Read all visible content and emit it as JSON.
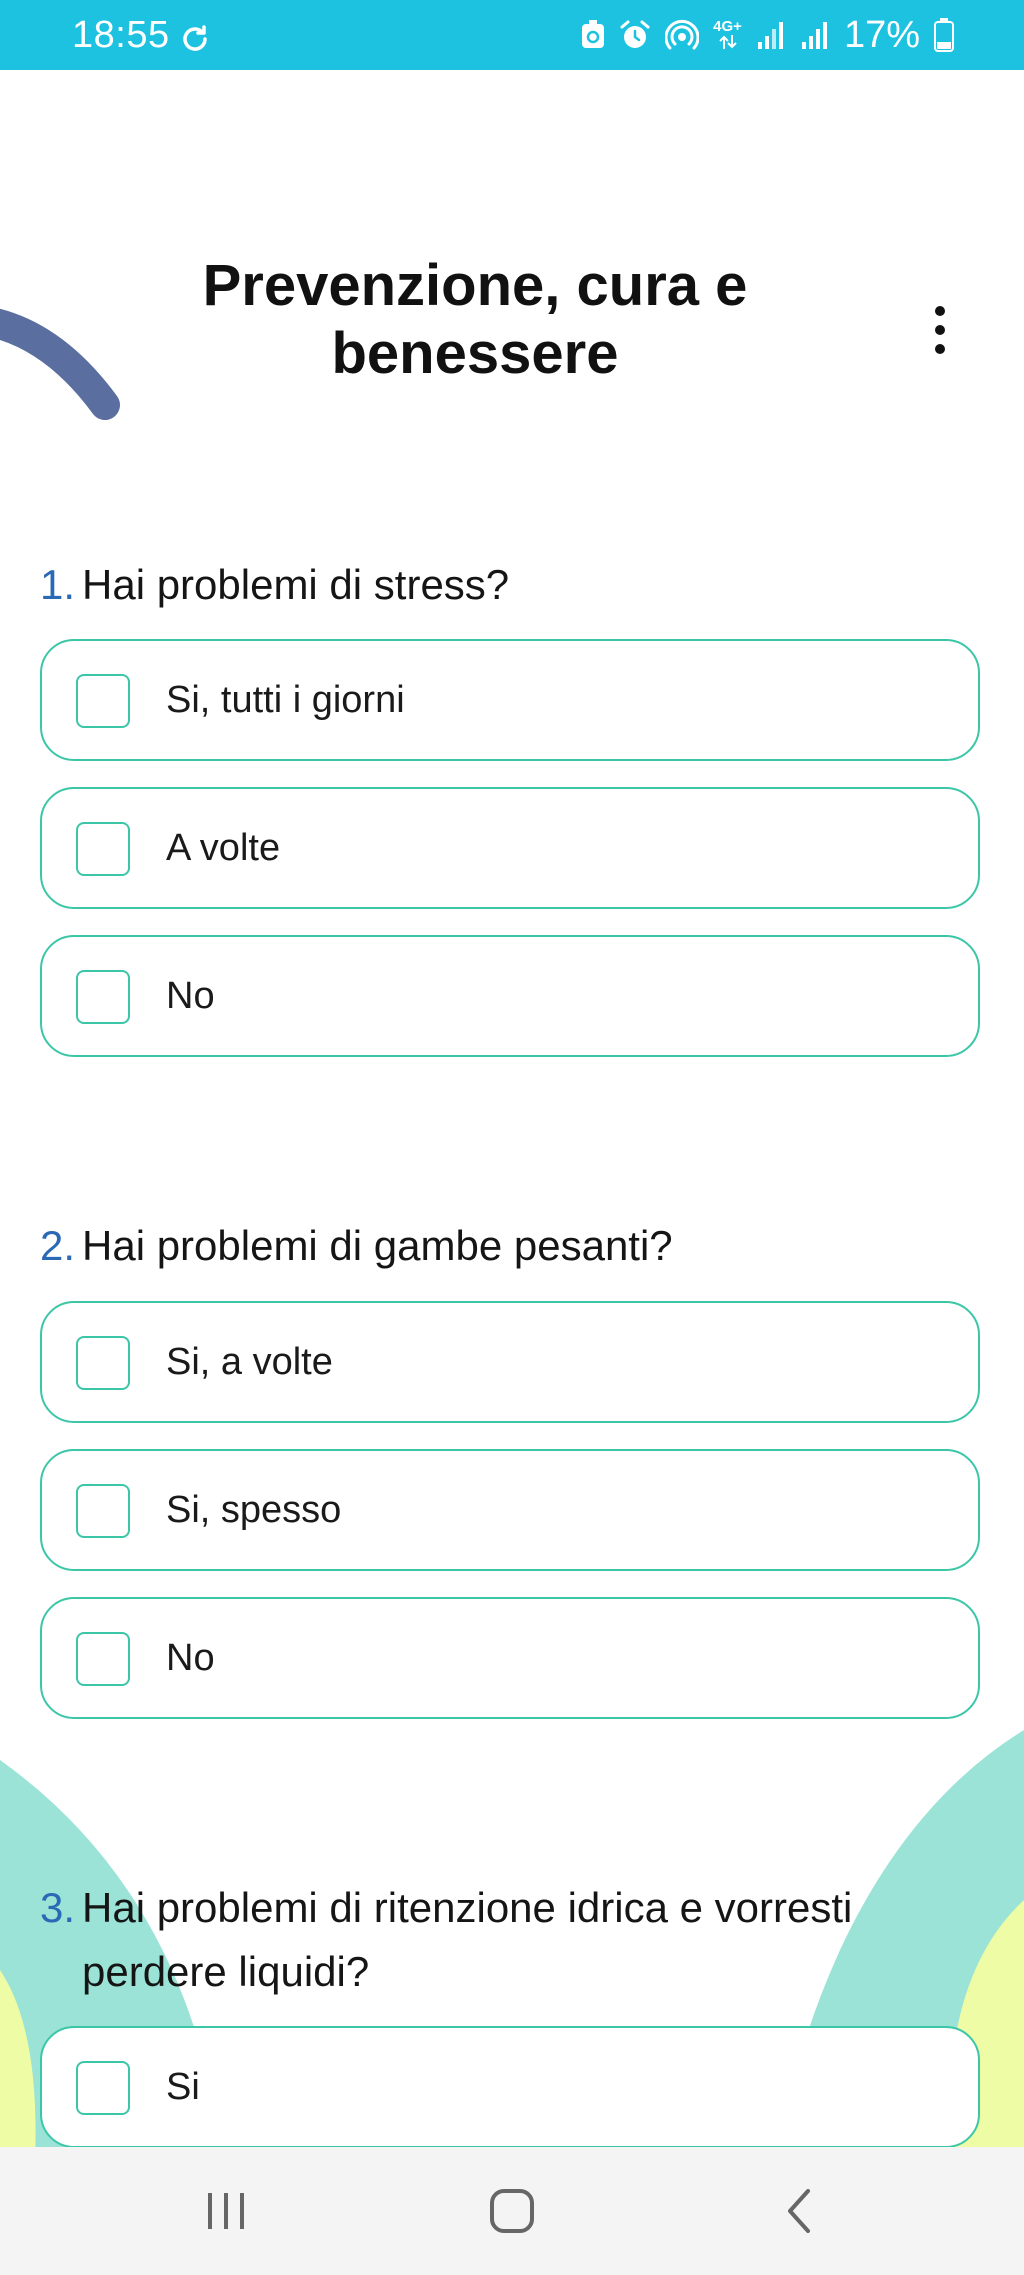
{
  "status_bar": {
    "time": "18:55",
    "battery": "17%",
    "network": "4G+",
    "icons": [
      "sync-icon",
      "recycle-badge-icon",
      "alarm-icon",
      "hotspot-icon",
      "data-arrows-icon",
      "signal-icon",
      "signal-icon",
      "battery-icon"
    ]
  },
  "header": {
    "title_line1": "Prevenzione, cura e",
    "title_line2": "benessere",
    "menu_icon": "more-vert-icon"
  },
  "colors": {
    "status_bar": "#1cc2e0",
    "option_border": "#3cc6a8",
    "question_number": "#2a69b5",
    "deco_stroke": "#5a6fa0",
    "deco_teal": "#9ae3d6",
    "deco_yellow": "#eefca6"
  },
  "questions": [
    {
      "number": "1.",
      "text": "Hai problemi di stress?",
      "options": [
        "Si, tutti i giorni",
        "A volte",
        "No"
      ]
    },
    {
      "number": "2.",
      "text": "Hai problemi di gambe pesanti?",
      "options": [
        "Si, a volte",
        "Si, spesso",
        "No"
      ]
    },
    {
      "number": "3.",
      "text": "Hai problemi di ritenzione idrica e vorresti perdere liquidi?",
      "options": [
        "Si"
      ]
    }
  ],
  "nav_bar": {
    "icons": [
      "recent-apps-icon",
      "home-icon",
      "back-icon"
    ]
  }
}
